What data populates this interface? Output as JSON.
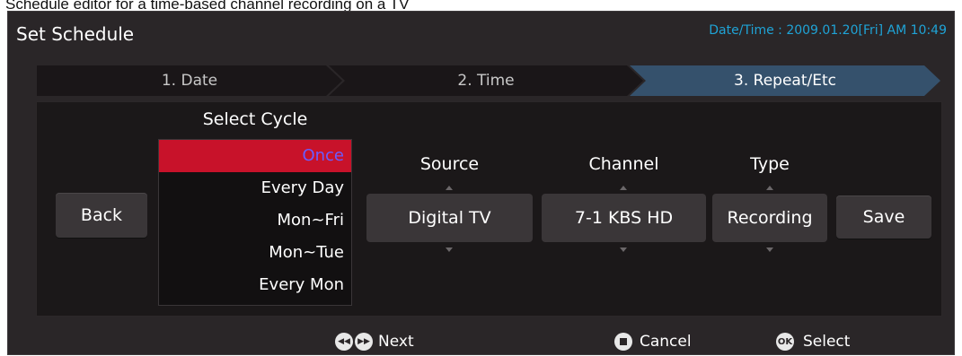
{
  "caption": "Schedule editor for a time-based channel recording on a TV",
  "header": {
    "title": "Set Schedule",
    "datetime_label": "Date/Time : ",
    "datetime_value": "2009.01.20[Fri] AM 10:49"
  },
  "steps": [
    {
      "label": "1. Date",
      "active": false
    },
    {
      "label": "2. Time",
      "active": false
    },
    {
      "label": "3. Repeat/Etc",
      "active": true
    }
  ],
  "buttons": {
    "back": "Back",
    "save": "Save"
  },
  "cycle": {
    "heading": "Select Cycle",
    "options": [
      "Once",
      "Every Day",
      "Mon~Fri",
      "Mon~Tue",
      "Every Mon"
    ],
    "selected": "Once"
  },
  "fields": {
    "source": {
      "heading": "Source",
      "value": "Digital TV"
    },
    "channel": {
      "heading": "Channel",
      "value": "7-1 KBS HD"
    },
    "type": {
      "heading": "Type",
      "value": "Recording"
    }
  },
  "footer": {
    "next_label": "Next",
    "cancel_label": "Cancel",
    "select_label": "Select",
    "ok_icon_text": "OK"
  },
  "colors": {
    "panel_bg": "#2a2628",
    "accent_blue": "#1fa3d6",
    "selected_red": "#c8122a",
    "active_step": "#35516c"
  }
}
